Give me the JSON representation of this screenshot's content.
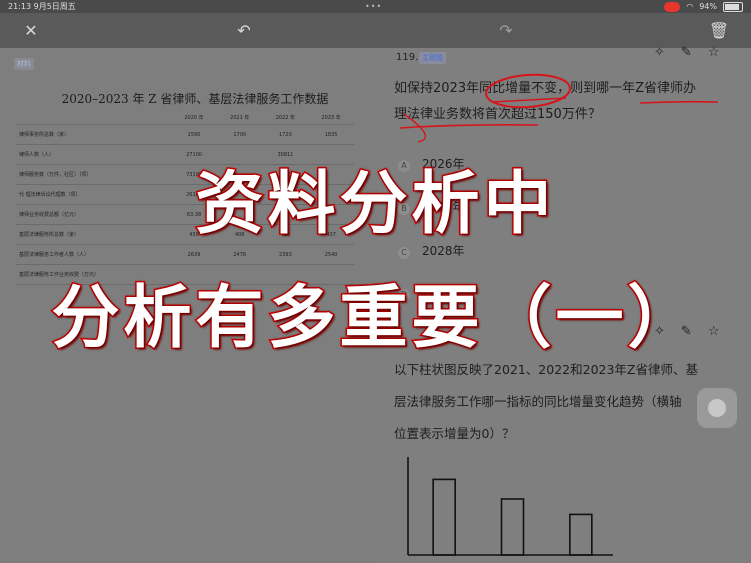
{
  "status": {
    "time": "21:13",
    "date": "9月5日周五",
    "battery": "94%"
  },
  "toolbar": {
    "close_icon": "close-icon",
    "undo_icon": "undo-icon",
    "redo_icon": "redo-icon",
    "trash_icon": "trash-icon"
  },
  "left": {
    "tag": "材料",
    "table_title": "2020–2023 年 Z 省律师、基层法律服务工作数据",
    "columns": [
      "",
      "2020 年",
      "2021 年",
      "2022 年",
      "2023 年"
    ],
    "rows": [
      {
        "label": "律师事务所总数（家）",
        "values": [
          "1590",
          "1700",
          "1720",
          "1835"
        ]
      },
      {
        "label": "律师人数（人）",
        "values": [
          "27100",
          "",
          "30811",
          ""
        ]
      },
      {
        "label": "律师服务数（万件，社区）（项）",
        "values": [
          "73196",
          "",
          "",
          ""
        ]
      },
      {
        "label": "代 理法律诉讼代理数（项）",
        "values": [
          "26163",
          "",
          "",
          ""
        ]
      },
      {
        "label": "律师业务收费总额（亿元）",
        "values": [
          "63.38",
          "",
          "",
          ""
        ]
      },
      {
        "label": "基层法律服务所总数（家）",
        "values": [
          "439",
          "408",
          "422",
          "437"
        ]
      },
      {
        "label": "基层法律服务工作者人数（人）",
        "values": [
          "2639",
          "2476",
          "2393",
          "2540"
        ]
      },
      {
        "label": "基层法律服务工作业务收费（万元）",
        "values": [
          "",
          "",
          "",
          ""
        ]
      }
    ]
  },
  "question1": {
    "number": "119.",
    "badge": "主观题",
    "line1": "如保持2023年同比增量不变，则到哪一年Z省律师办",
    "line2": "理法律业务数将首次超过150万件？",
    "options": [
      {
        "letter": "A",
        "text": "2026年"
      },
      {
        "letter": "B",
        "text": "2027年"
      },
      {
        "letter": "C",
        "text": "2028年"
      },
      {
        "letter": "D",
        "text": "2029年"
      }
    ]
  },
  "question2": {
    "line1": "以下柱状图反映了2021、2022和2023年Z省律师、基",
    "line2": "层法律服务工作哪一指标的同比增量变化趋势（横轴",
    "line3": "位置表示增量为0）？"
  },
  "chart_data": {
    "type": "bar",
    "categories": [
      "",
      "",
      ""
    ],
    "values": [
      5.4,
      4.0,
      2.9
    ],
    "title": "",
    "xlabel": "",
    "ylabel": "",
    "ylim": [
      0,
      7
    ]
  },
  "overlay": {
    "line1": "资料分析中",
    "line2": "分析有多重要（一）"
  },
  "colors": {
    "overlay_stroke": "#d80000",
    "annotation": "#d4161c"
  }
}
